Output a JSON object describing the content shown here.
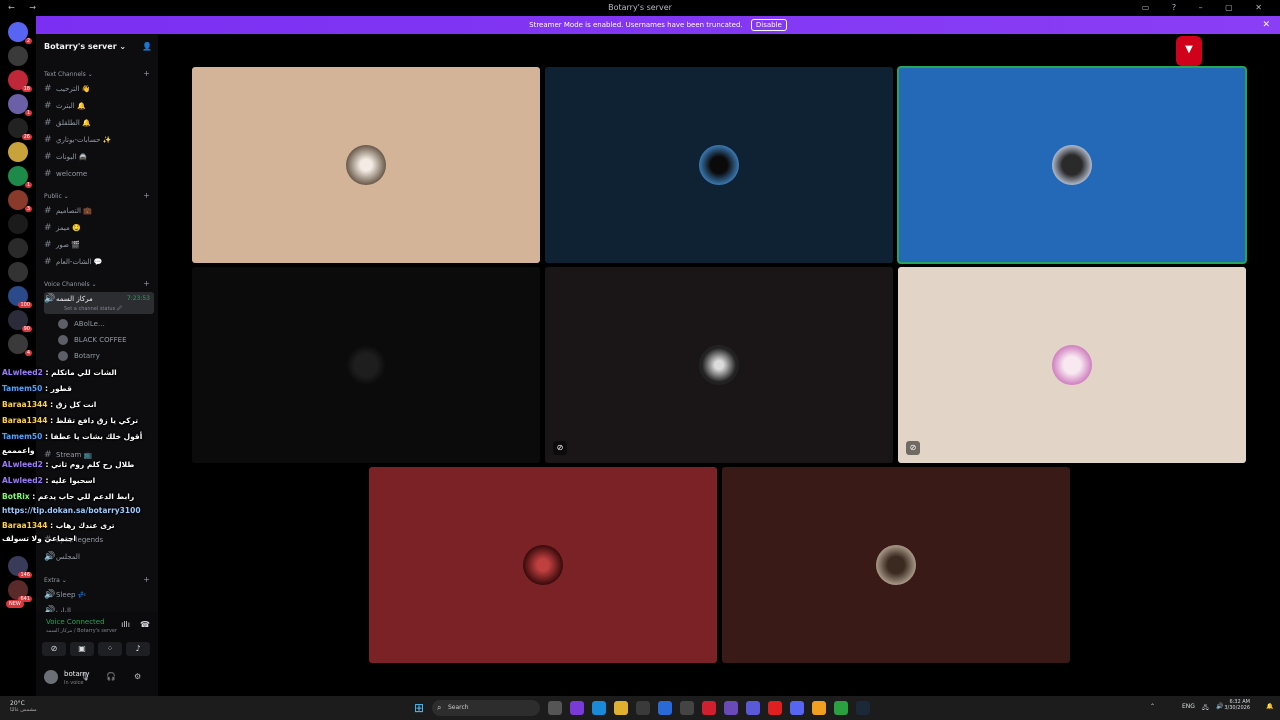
{
  "titlebar": {
    "title": "Botarry's server"
  },
  "banner": {
    "text": "Streamer Mode is enabled. Usernames have been truncated.",
    "disable_label": "Disable"
  },
  "server": {
    "name": "Botarry's server ⌄"
  },
  "categories": {
    "text": "Text Channels ⌄",
    "public": "Public ⌄",
    "voice": "Voice Channels ⌄",
    "extra": "Extra ⌄"
  },
  "text_channels": [
    "الترحيب 👋",
    "البترث 🔔",
    "الطلقلق 🔔",
    "حسابات-بوتاري ✨",
    "البونات 🚔",
    "welcome"
  ],
  "public_channels": [
    "التصاميم 💼",
    "ميمز 🤤",
    "صور 🎬",
    "الشات-العام 💬"
  ],
  "voice_channel": {
    "name": "مركاز السمه",
    "time": "7:23:53",
    "status": "Set a channel status 🖉"
  },
  "voice_members": [
    "ABolLe…",
    "BLACK COFFEE",
    "Botarry"
  ],
  "lower_channels": [
    "Stream 📺",
    "apex-legends",
    "المجلس"
  ],
  "extra_channels": [
    "Sleep 💤",
    "الباب"
  ],
  "chat": [
    {
      "user": "ALwleed2",
      "msg": ": الشات للي ماتكلم"
    },
    {
      "user": "Tamem50",
      "msg": ": قطور"
    },
    {
      "user": "Baraa1344",
      "msg": ": انت كل زق"
    },
    {
      "user": "Baraa1344",
      "msg": ": تركي يا زق دافع تقلظ"
    },
    {
      "user": "Tamem50",
      "msg": ": أقول خلك بشات يا عطفا"
    },
    {
      "user": "",
      "msg": "واعمممع"
    },
    {
      "user": "ALwleed2",
      "msg": ": طلال رح كلم روم ثاني"
    },
    {
      "user": "ALwleed2",
      "msg": ": اسحبوا عليه"
    },
    {
      "user": "BotRix",
      "msg": ": رابط الدعم للي حاب يدعم"
    },
    {
      "user": "",
      "msg": "https://tip.dokan.sa/botarry3100"
    },
    {
      "user": "Baraa1344",
      "msg": ": ترى عندك رهاب"
    },
    {
      "user": "",
      "msg": "اجتماعي ولا تسولف"
    }
  ],
  "voice_panel": {
    "status": "Voice Connected",
    "sub": "مركاز السمه / Botarry's server"
  },
  "user_panel": {
    "name": "botarry",
    "status": "In voice"
  },
  "guild_badges": [
    "2",
    "18",
    "1",
    "26",
    "1",
    "3",
    "100",
    "90",
    "4",
    "146",
    "641",
    "NEW"
  ],
  "taskbar": {
    "weather_temp": "20°C",
    "weather_desc": "مشمس غالبًا",
    "search": "Search",
    "lang": "ENG",
    "time": "6:32 AM",
    "date": "3/30/2026"
  },
  "colors": {
    "tile_1": "#d4b498",
    "tile_2": "#0e2234",
    "tile_3": "#2468b8",
    "tile_4": "#0b0b0b",
    "tile_5": "#1a1617",
    "tile_6": "#e2d4c6",
    "tile_7": "#7b2227",
    "tile_8": "#3a1a16",
    "speaking": "#23a55a",
    "banner": "#7b2ff2"
  }
}
